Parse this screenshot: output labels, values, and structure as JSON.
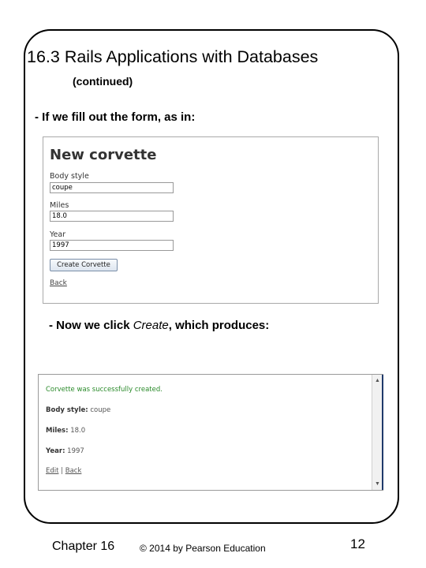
{
  "slide": {
    "title": "16.3 Rails Applications with Databases",
    "subtitle": "(continued)",
    "bullet1": "- If we fill out the form, as in:",
    "bullet2_prefix": "- Now we click ",
    "bullet2_emph": "Create",
    "bullet2_suffix": ", which produces:"
  },
  "form_screenshot": {
    "heading": "New corvette",
    "fields": [
      {
        "label": "Body style",
        "value": "coupe"
      },
      {
        "label": "Miles",
        "value": "18.0"
      },
      {
        "label": "Year",
        "value": "1997"
      }
    ],
    "submit_label": "Create Corvette",
    "back_link": "Back"
  },
  "result_screenshot": {
    "notice": "Corvette was successfully created.",
    "rows": [
      {
        "label": "Body style:",
        "value": "coupe"
      },
      {
        "label": "Miles:",
        "value": "18.0"
      },
      {
        "label": "Year:",
        "value": "1997"
      }
    ],
    "edit_link": "Edit",
    "separator": "|",
    "back_link": "Back",
    "scroll_up_icon": "▲",
    "scroll_down_icon": "▼"
  },
  "footer": {
    "chapter": "Chapter 16",
    "copyright": "© 2014 by Pearson Education",
    "page_number": "12"
  }
}
